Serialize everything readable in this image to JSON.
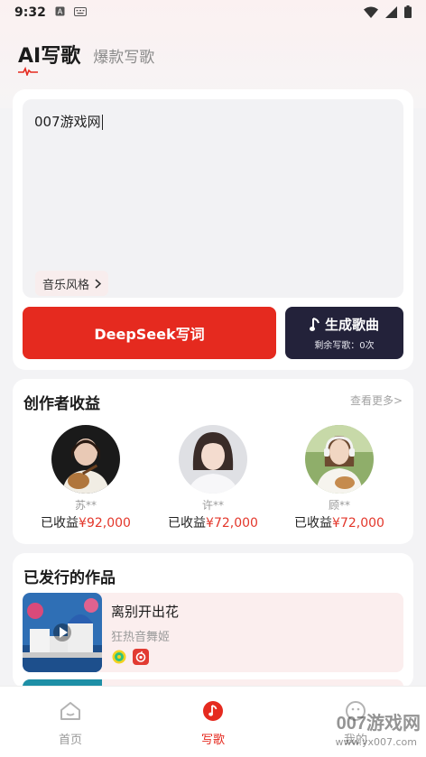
{
  "status_bar": {
    "time": "9:32"
  },
  "header": {
    "title": "AI写歌",
    "subtitle_tab": "爆款写歌"
  },
  "editor": {
    "text": "007游戏网",
    "style_chip": "音乐风格",
    "deepseek_button": "DeepSeek写词",
    "generate_button": "生成歌曲",
    "remaining_label": "剩余写歌：0次"
  },
  "earnings": {
    "title": "创作者收益",
    "see_more": "查看更多>",
    "creators": [
      {
        "name": "苏**",
        "label": "已收益",
        "amount": "¥92,000"
      },
      {
        "name": "许**",
        "label": "已收益",
        "amount": "¥72,000"
      },
      {
        "name": "顾**",
        "label": "已收益",
        "amount": "¥72,000"
      }
    ]
  },
  "works": {
    "title": "已发行的作品",
    "items": [
      {
        "title": "离别开出花",
        "artist": "狂热音舞姬"
      }
    ]
  },
  "tabbar": {
    "tabs": [
      {
        "label": "首页",
        "icon": "home-icon"
      },
      {
        "label": "写歌",
        "icon": "music-note-icon"
      },
      {
        "label": "我的",
        "icon": "profile-icon"
      }
    ]
  },
  "watermark": {
    "text": "007游戏网",
    "url": "www.yx007.com"
  },
  "colors": {
    "accent": "#e52a1f",
    "dark_button": "#23223a",
    "amount": "#e3372b"
  }
}
